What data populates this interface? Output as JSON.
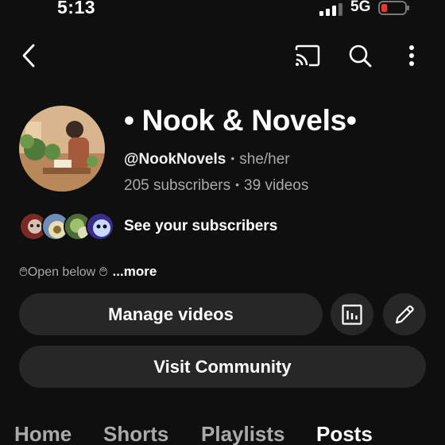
{
  "status_bar": {
    "time": "5:13",
    "network": "5G",
    "battery_color": "#e53935"
  },
  "app_bar": {
    "icons": [
      "chevron-left-icon",
      "cast-icon",
      "search-icon",
      "more-vert-icon"
    ]
  },
  "channel": {
    "name": "• Nook & Novels•",
    "handle": "@NookNovels",
    "pronouns": "she/her",
    "subscribers": "205 subscribers",
    "videos": "39 videos"
  },
  "subscribers_row": {
    "label": "See your subscribers"
  },
  "description": {
    "text": "࿉Open below ࿉",
    "more_label": "...more"
  },
  "actions": {
    "manage_label": "Manage videos",
    "community_label": "Visit Community"
  },
  "tabs": [
    {
      "label": "Home",
      "active": false
    },
    {
      "label": "Shorts",
      "active": false
    },
    {
      "label": "Playlists",
      "active": false
    },
    {
      "label": "Posts",
      "active": true
    }
  ],
  "colors": {
    "background": "#0f0f0f",
    "button_bg": "#272727",
    "muted_text": "#aaaaaa"
  }
}
